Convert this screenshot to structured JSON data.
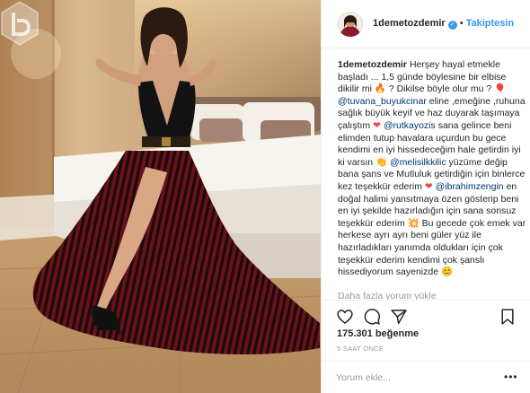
{
  "header": {
    "username": "1demetozdemir",
    "separator": "•",
    "follow_label": "Takiptesin"
  },
  "caption": {
    "author": "1demetozdemir",
    "p1": "Herşey hayal etmekle başladı ... 1,5 günde böylesine bir elbise dikilir mi",
    "e1": "🔥",
    "p2": "? Dikilse böyle olur mu ?",
    "e2": "🎈",
    "m1": "@tuvana_buyukcinar",
    "p3": "eline ,emeğine ,ruhuna sağlık büyük keyif ve haz duyarak taşımaya çalıştım",
    "e3": "❤",
    "m2": "@rutkayozis",
    "p4": "sana gelince beni elimden tutup havalara uçurdun bu gece kendimi en iyi hissedeceğim hale getirdin iyi ki varsın",
    "e4": "👏",
    "m3": "@melisilkkilic",
    "p5": "yüzüme değip bana şans ve Mutluluk getirdiğin için binlerce kez teşekkür ederim",
    "e5": "❤",
    "m4": "@ibrahimzengin",
    "p6": "en doğal halimi yansıtmaya özen gösterip beni en iyi şekilde hazırladığın için sana sonsuz teşekkür ederim",
    "e6": "💥",
    "p7": "Bu gecede çok emek var herkese ayrı ayrı beni güler yüz ile hazırladıkları yanımda oldukları için çok teşekkür ederim kendimi çok şanslı hissediyorum sayenizde",
    "e7": "😊"
  },
  "more_comments_label": "Daha fazla yorum yükle",
  "likes": "175.301 beğenme",
  "timestamp": "5 SAAT ÖNCE",
  "comment": {
    "placeholder": "Yorum ekle...",
    "value": "",
    "more_label": "•••"
  },
  "icons": {
    "like": "heart-icon",
    "comment": "comment-icon",
    "share": "share-icon",
    "save": "bookmark-icon",
    "verified": "verified-badge-icon"
  },
  "colors": {
    "accent": "#3897f0",
    "text": "#262626",
    "muted": "#999999",
    "border": "#efefef",
    "heart": "#ed4956"
  }
}
